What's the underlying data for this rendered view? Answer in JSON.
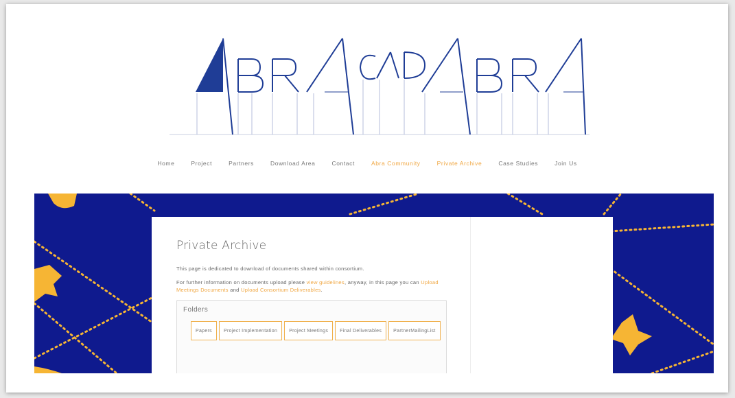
{
  "logo": {
    "text": "ABRACADABRA",
    "color": "#1f3d96"
  },
  "nav": {
    "items": [
      {
        "label": "Home",
        "highlight": false
      },
      {
        "label": "Project",
        "highlight": false
      },
      {
        "label": "Partners",
        "highlight": false
      },
      {
        "label": "Download Area",
        "highlight": false
      },
      {
        "label": "Contact",
        "highlight": false
      },
      {
        "label": "Abra Community",
        "highlight": true
      },
      {
        "label": "Private Archive",
        "highlight": true
      },
      {
        "label": "Case Studies",
        "highlight": false
      },
      {
        "label": "Join Us",
        "highlight": false
      }
    ]
  },
  "page": {
    "title": "Private Archive",
    "intro": "This page is dedicated to download of documents shared within consortium.",
    "info_prefix": "For further information on documents upload please ",
    "info_link": "view guidelines",
    "info_middle": ", anyway, in this page you can ",
    "upload_meetings_link": "Upload Meetings Documents",
    "info_and": " and ",
    "upload_deliverables_link": "Upload Consortium Deliverables",
    "info_suffix": "."
  },
  "folders": {
    "label": "Folders",
    "items": [
      "Papers",
      "Project Implementation",
      "Project Meetings",
      "Final Deliverables",
      "PartnerMailingList"
    ]
  },
  "colors": {
    "banner_bg": "#0f1a8e",
    "accent_orange": "#f0a640",
    "star_yellow": "#f6b534"
  }
}
